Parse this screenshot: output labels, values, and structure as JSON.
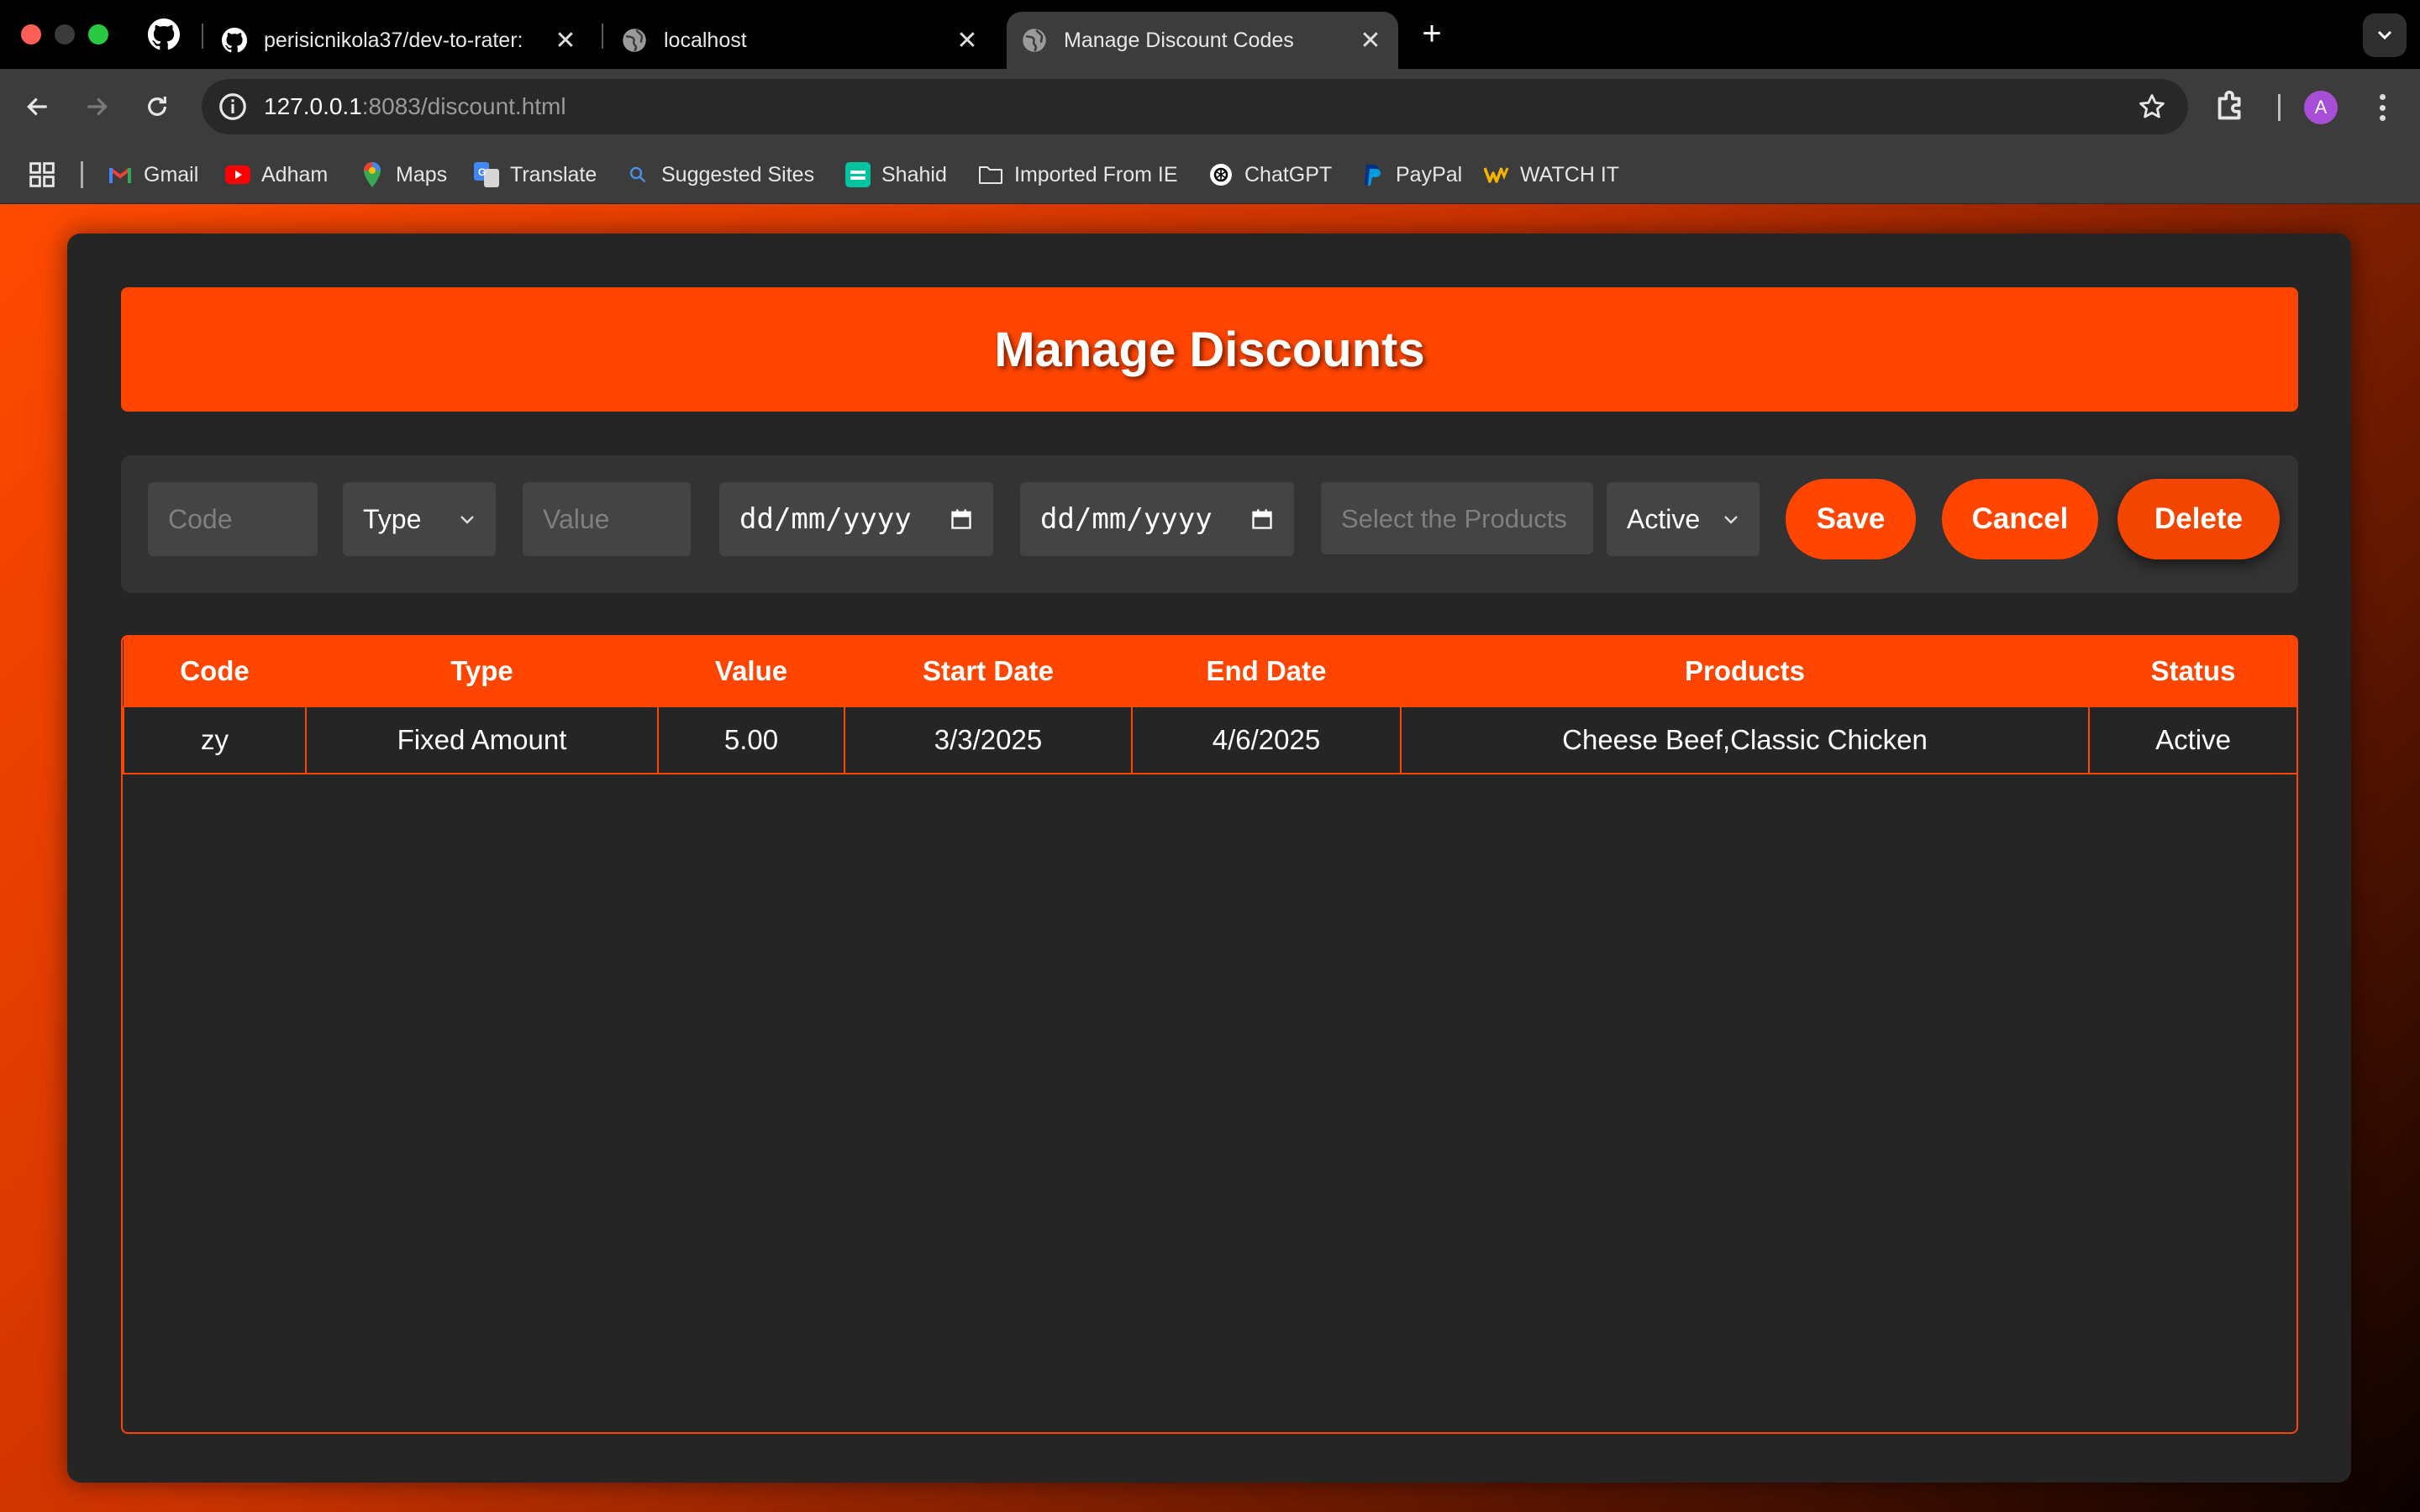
{
  "browser": {
    "tabs": [
      {
        "title": "perisicnikola37/dev-to-rater: ",
        "close": "✕"
      },
      {
        "title": "localhost",
        "close": "✕"
      },
      {
        "title": "Manage Discount Codes",
        "close": "✕"
      }
    ],
    "new_tab": "+",
    "url_host": "127.0.0.1",
    "url_rest": ":8083/discount.html",
    "avatar_letter": "A",
    "bookmarks": [
      {
        "label": "Gmail",
        "icon": "gmail-icon"
      },
      {
        "label": "Adham",
        "icon": "youtube-icon"
      },
      {
        "label": "Maps",
        "icon": "maps-pin-icon"
      },
      {
        "label": "Translate",
        "icon": "translate-icon"
      },
      {
        "label": "Suggested Sites",
        "icon": "search-icon"
      },
      {
        "label": "Shahid",
        "icon": "shahid-icon"
      },
      {
        "label": "Imported From IE",
        "icon": "folder-icon"
      },
      {
        "label": "ChatGPT",
        "icon": "chatgpt-icon"
      },
      {
        "label": "PayPal",
        "icon": "paypal-icon"
      },
      {
        "label": "WATCH IT",
        "icon": "watchit-icon"
      }
    ]
  },
  "page": {
    "title": "Manage Discounts",
    "form": {
      "code_placeholder": "Code",
      "type_value": "Type",
      "value_placeholder": "Value",
      "start_date": "dd/mm/yyyy",
      "end_date": "dd/mm/yyyy",
      "products_placeholder": "Select the Products",
      "status_value": "Active",
      "save_label": "Save",
      "cancel_label": "Cancel",
      "delete_label": "Delete"
    },
    "table": {
      "headers": [
        "Code",
        "Type",
        "Value",
        "Start Date",
        "End Date",
        "Products",
        "Status"
      ],
      "rows": [
        [
          "zy",
          "Fixed Amount",
          "5.00",
          "3/3/2025",
          "4/6/2025",
          "Cheese Beef,Classic Chicken",
          "Active"
        ]
      ]
    }
  },
  "colors": {
    "accent": "#ff4500",
    "panel": "#252525",
    "form_bg": "#333333",
    "field_bg": "#444444"
  }
}
